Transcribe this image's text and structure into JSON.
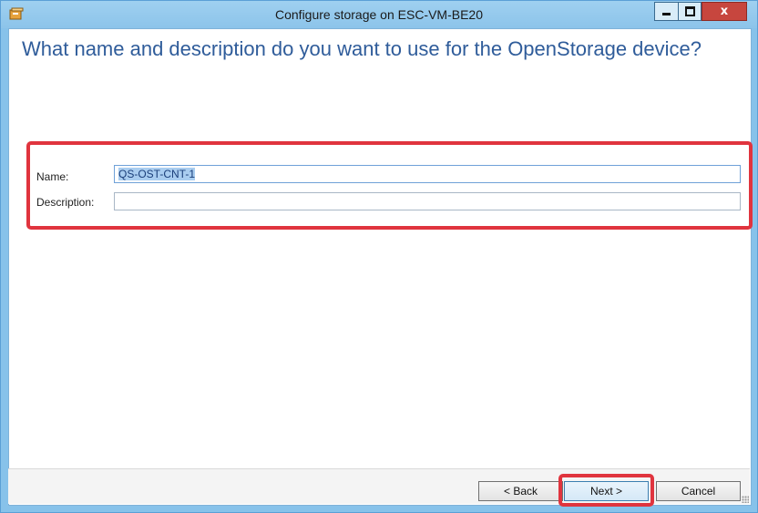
{
  "window": {
    "title": "Configure storage on ESC-VM-BE20",
    "minimize_icon": "minimize-icon",
    "maximize_icon": "maximize-icon",
    "close_icon": "close-icon",
    "close_glyph": "x"
  },
  "page": {
    "heading": "What name and description do you want to use for the OpenStorage device?"
  },
  "form": {
    "name_label": "Name:",
    "name_value": "QS-OST-CNT-1",
    "description_label": "Description:",
    "description_value": ""
  },
  "footer": {
    "back_label": "< Back",
    "next_label": "Next >",
    "cancel_label": "Cancel"
  },
  "colors": {
    "title_bar": "#8cc4ea",
    "heading_text": "#2f5c9a",
    "highlight_box": "#e0343e",
    "close_button": "#c7463e"
  }
}
